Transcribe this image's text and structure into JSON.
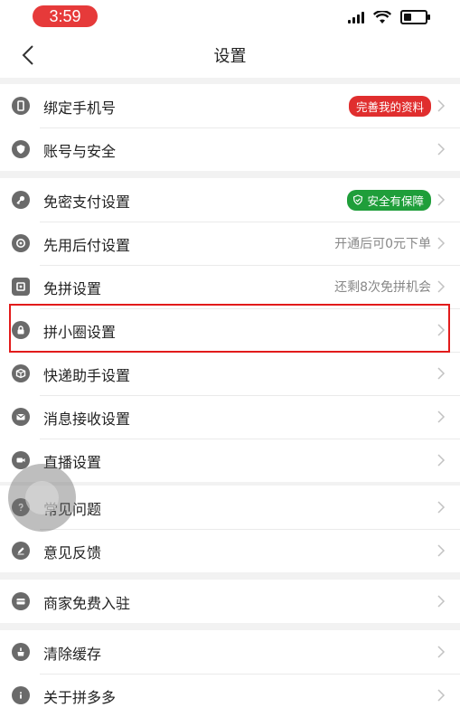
{
  "status_bar": {
    "time": "3:59"
  },
  "nav": {
    "title": "设置"
  },
  "groups": [
    {
      "items": [
        {
          "label": "绑定手机号",
          "badge": "完善我的资料"
        },
        {
          "label": "账号与安全"
        }
      ]
    },
    {
      "items": [
        {
          "label": "免密支付设置",
          "badge": "安全有保障"
        },
        {
          "label": "先用后付设置",
          "value": "开通后可0元下单"
        },
        {
          "label": "免拼设置",
          "value": "还剩8次免拼机会"
        },
        {
          "label": "拼小圈设置"
        },
        {
          "label": "快递助手设置"
        },
        {
          "label": "消息接收设置"
        },
        {
          "label": "直播设置"
        }
      ]
    },
    {
      "items": [
        {
          "label": "常见问题"
        },
        {
          "label": "意见反馈"
        }
      ]
    },
    {
      "items": [
        {
          "label": "商家免费入驻"
        }
      ]
    },
    {
      "items": [
        {
          "label": "清除缓存"
        },
        {
          "label": "关于拼多多"
        }
      ]
    }
  ],
  "colors": {
    "accent_red": "#e02e2e",
    "badge_green": "#1f9e3a",
    "highlight": "#e21b1b"
  }
}
